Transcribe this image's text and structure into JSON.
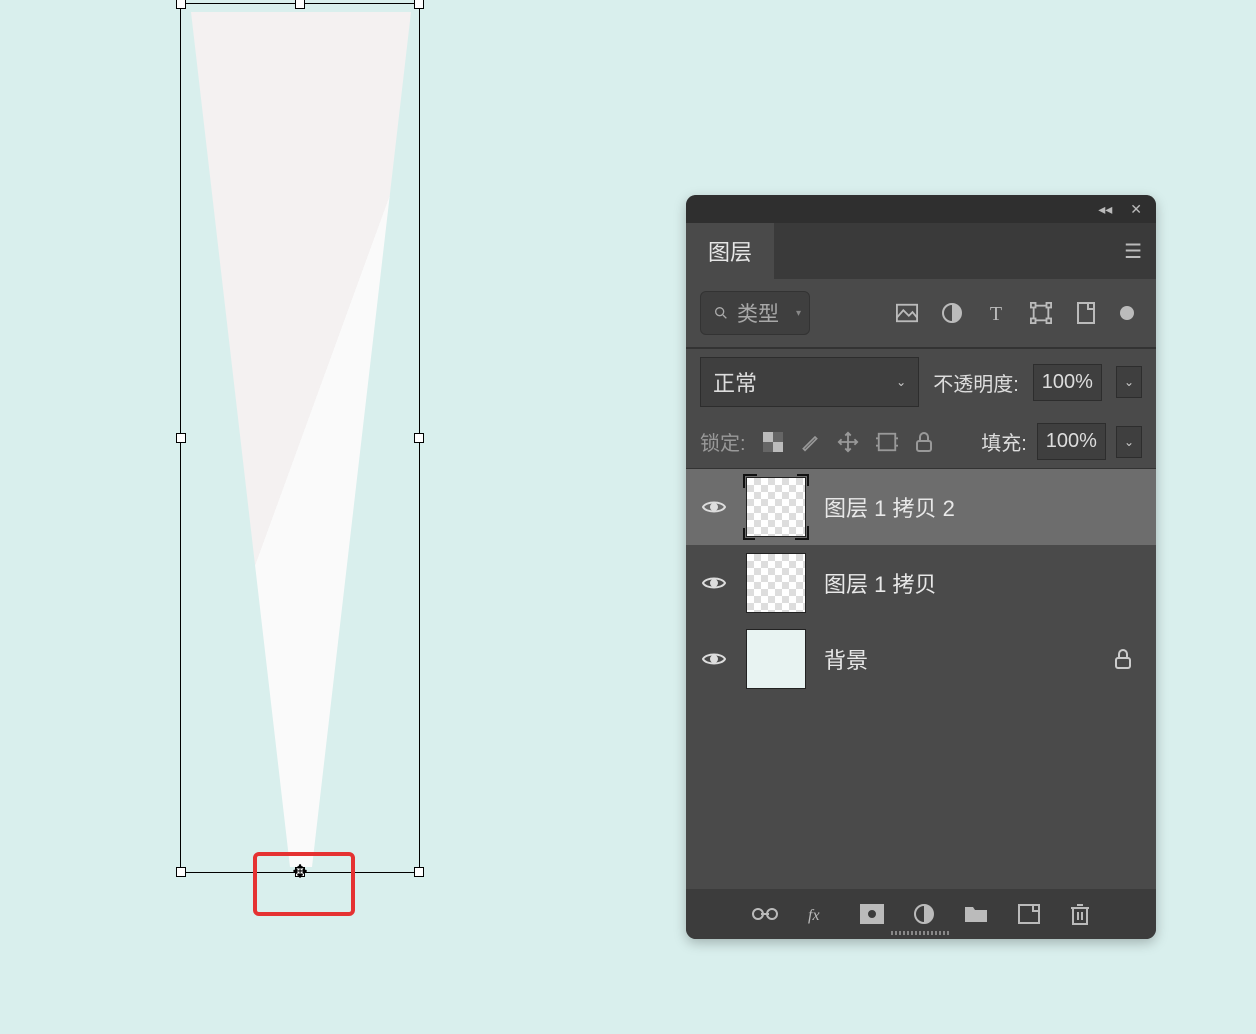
{
  "panel": {
    "tab_label": "图层",
    "search_label": "类型",
    "blend_mode": "正常",
    "opacity_label": "不透明度:",
    "opacity_value": "100%",
    "lock_label": "锁定:",
    "fill_label": "填充:",
    "fill_value": "100%",
    "layers": [
      {
        "name": "图层 1 拷贝 2",
        "selected": true,
        "locked": false,
        "thumb": "checker"
      },
      {
        "name": "图层 1 拷贝",
        "selected": false,
        "locked": false,
        "thumb": "checker"
      },
      {
        "name": "背景",
        "selected": false,
        "locked": true,
        "thumb": "solid"
      }
    ]
  }
}
